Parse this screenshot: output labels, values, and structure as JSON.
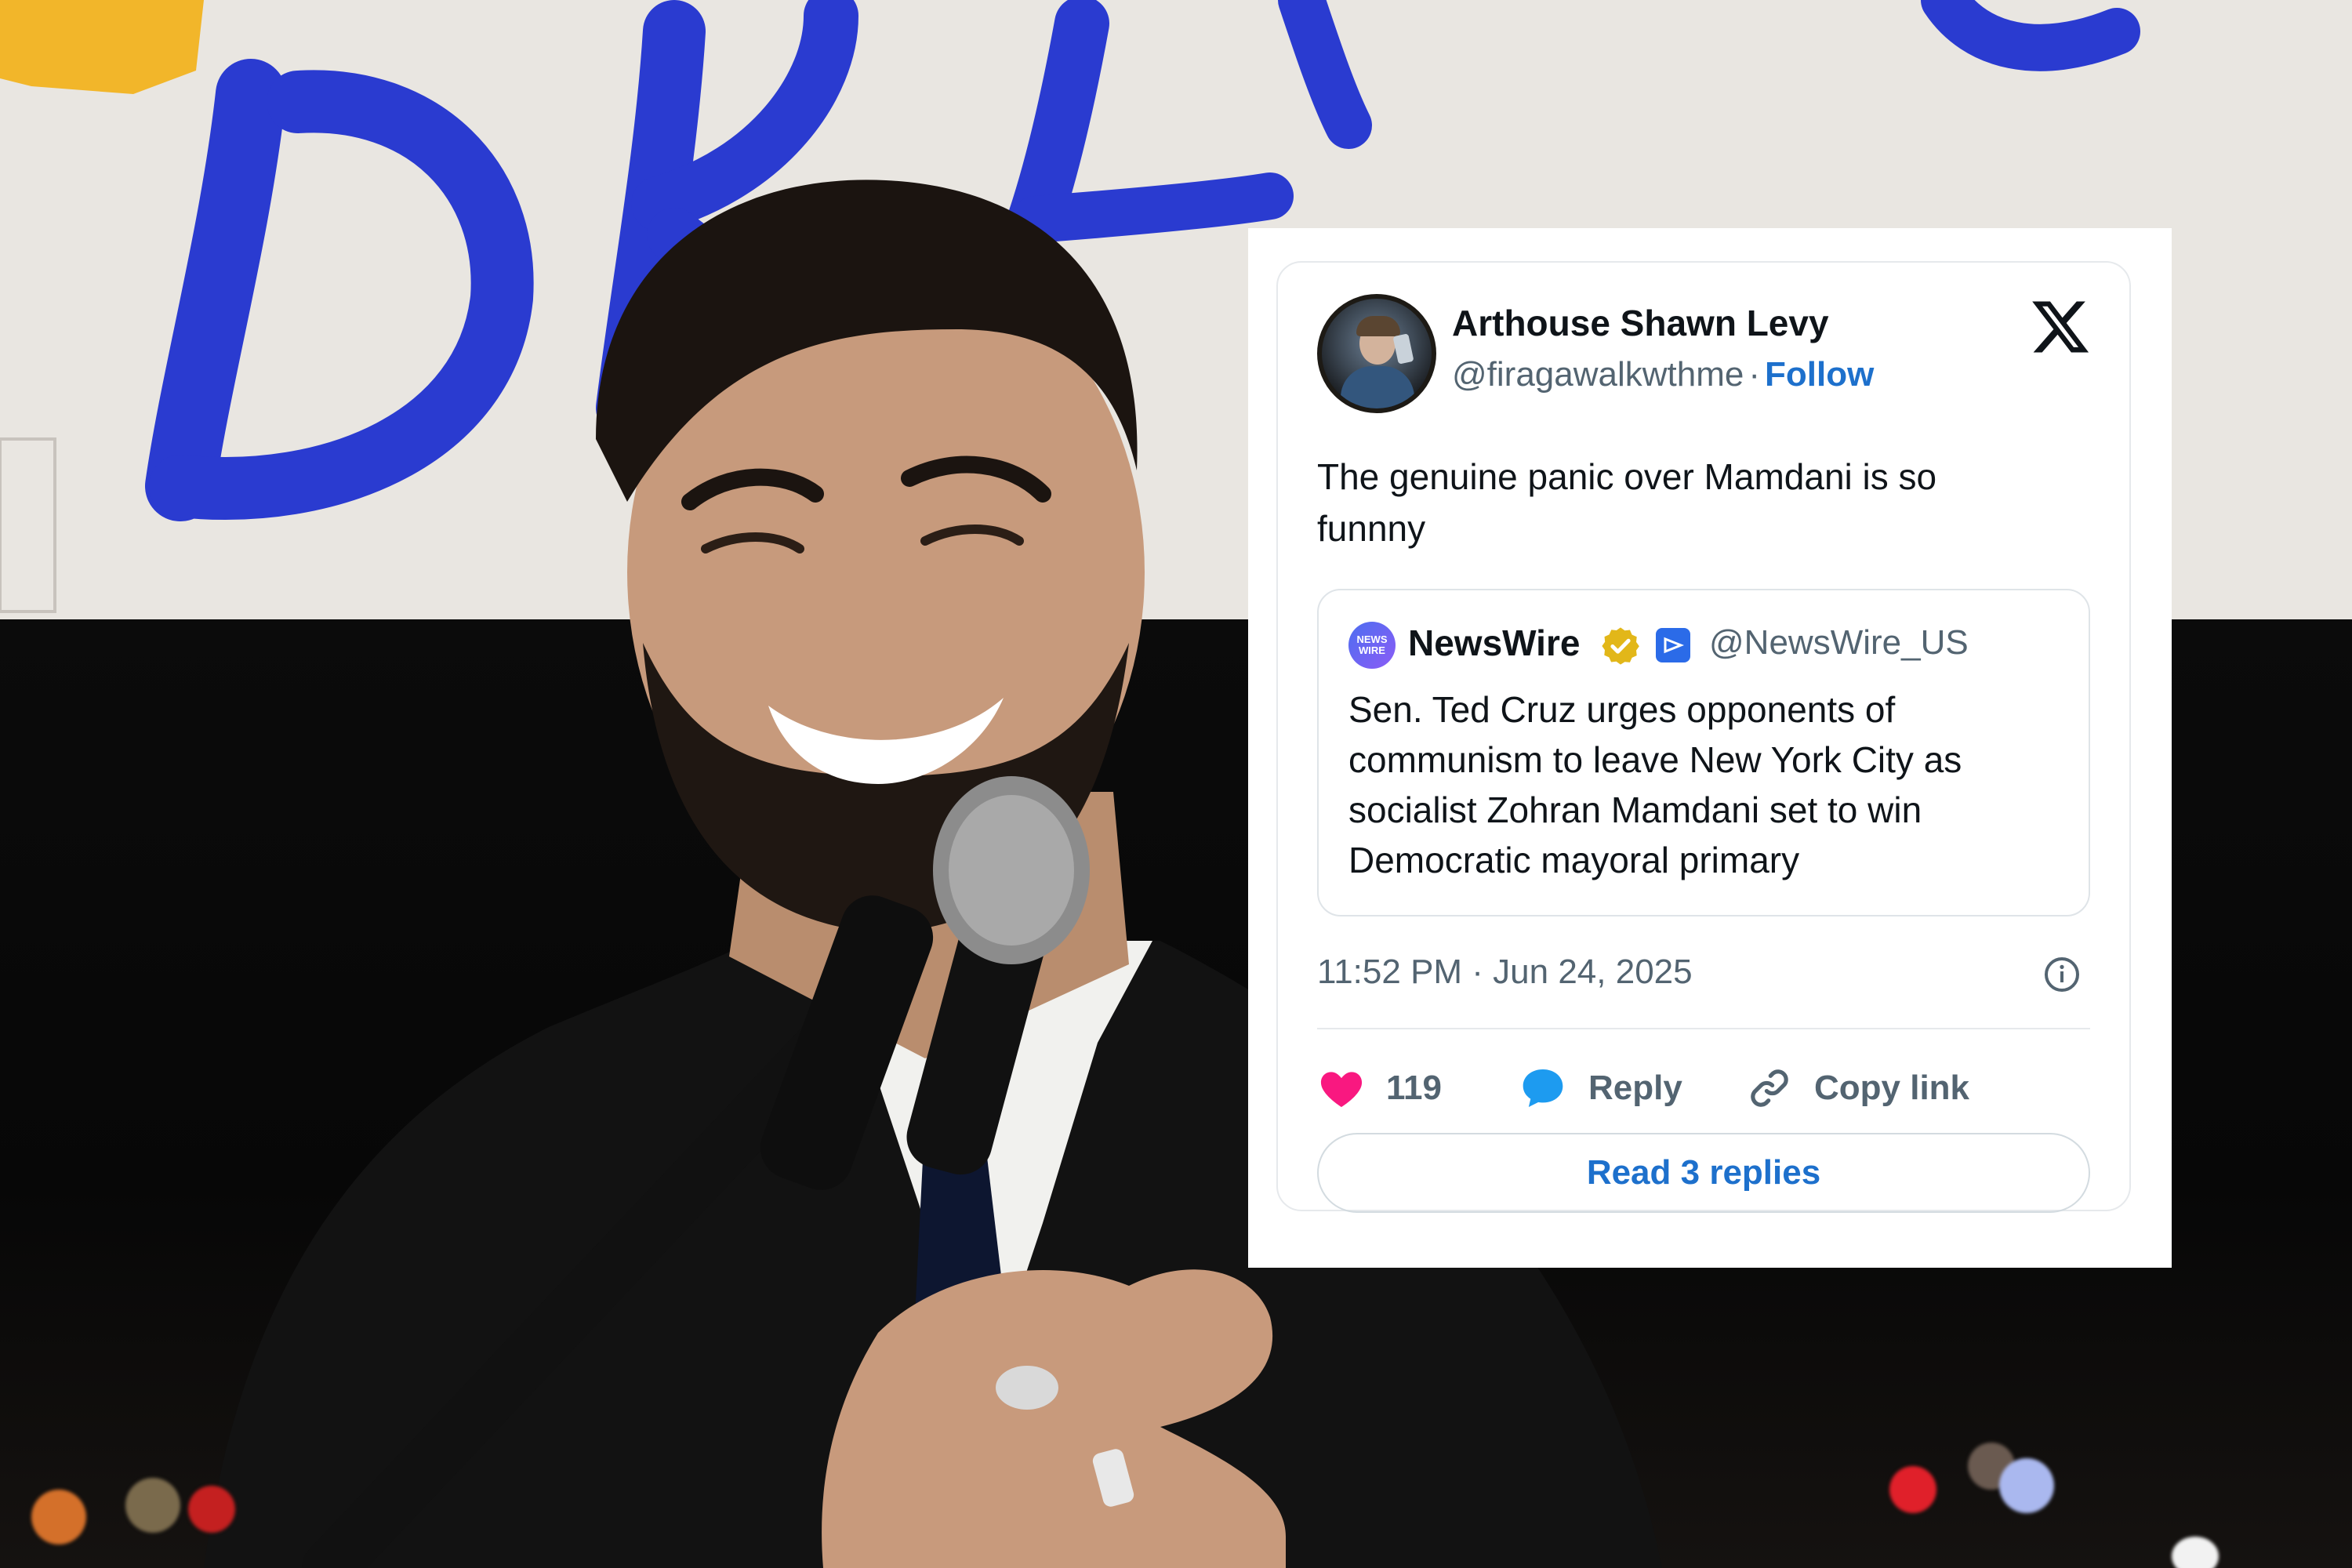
{
  "tweet": {
    "author_name": "Arthouse Shawn Levy",
    "author_handle": "@firagawalkwthme",
    "separator": "·",
    "follow_label": "Follow",
    "text": "The genuine panic over Mamdani is so funnny",
    "timestamp": "11:52 PM · Jun 24, 2025",
    "like_count": "119",
    "reply_label": "Reply",
    "copy_link_label": "Copy link",
    "read_replies_label": "Read 3 replies"
  },
  "quoted": {
    "author_name": "NewsWire",
    "author_handle": "@NewsWire_US",
    "avatar_text": "NEWS WIRE",
    "text": "Sen. Ted Cruz urges opponents of communism to leave New York City as socialist Zohran Mamdani set to win Democratic mayoral primary"
  },
  "icons": {
    "platform": "x-logo-icon",
    "like": "heart-icon",
    "reply": "speech-bubble-icon",
    "copy": "link-icon",
    "info": "info-icon",
    "verified": "gold-verified-badge-icon"
  },
  "colors": {
    "accent": "#1d70cc",
    "like": "#f91880",
    "reply": "#1d9bf0",
    "text": "#0f1419",
    "muted": "#536471",
    "verified": "#e2b719"
  }
}
